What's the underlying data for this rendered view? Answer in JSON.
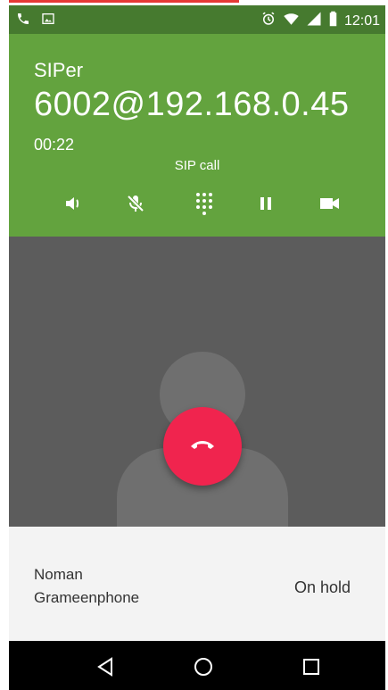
{
  "status_bar": {
    "time": "12:01",
    "left_icons": [
      "phone-icon",
      "image-icon"
    ],
    "right_icons": [
      "alarm-icon",
      "wifi-icon",
      "cell-signal-icon",
      "battery-icon"
    ]
  },
  "call": {
    "app_name": "SIPer",
    "address": "6002@192.168.0.45",
    "duration": "00:22",
    "call_type": "SIP call"
  },
  "controls": [
    "speaker-icon",
    "mute-icon",
    "dialpad-icon",
    "pause-icon",
    "video-icon"
  ],
  "held_call": {
    "name": "Noman",
    "carrier": "Grameenphone",
    "status": "On hold"
  },
  "colors": {
    "status_bar": "#467a2f",
    "call_panel": "#63a33e",
    "end_call": "#f0244e"
  }
}
